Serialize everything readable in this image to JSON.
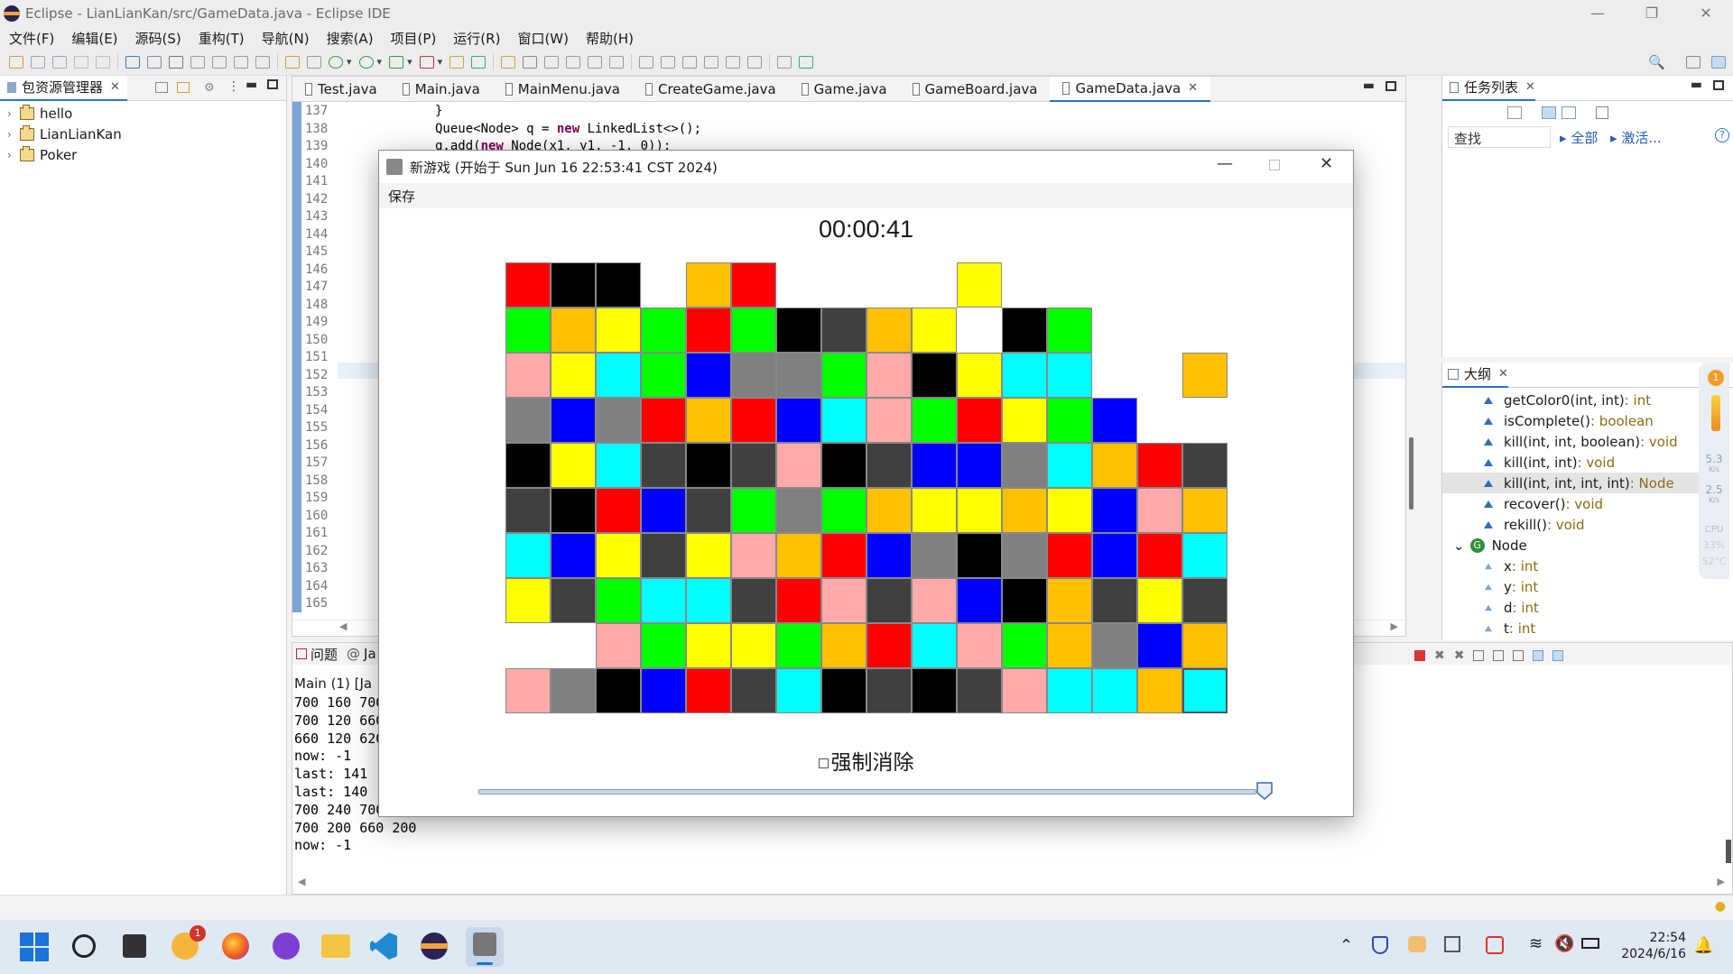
{
  "window": {
    "title": "Eclipse - LianLianKan/src/GameData.java - Eclipse IDE"
  },
  "menubar": [
    "文件(F)",
    "编辑(E)",
    "源码(S)",
    "重构(T)",
    "导航(N)",
    "搜索(A)",
    "项目(P)",
    "运行(R)",
    "窗口(W)",
    "帮助(H)"
  ],
  "package_explorer": {
    "title": "包资源管理器",
    "items": [
      "hello",
      "LianLianKan",
      "Poker"
    ]
  },
  "editor": {
    "tabs": [
      "Test.java",
      "Main.java",
      "MainMenu.java",
      "CreateGame.java",
      "Game.java",
      "GameBoard.java",
      "GameData.java"
    ],
    "active_tab": "GameData.java",
    "line_numbers": [
      "137",
      "138",
      "139",
      "140",
      "141",
      "142",
      "143",
      "144",
      "145",
      "146",
      "147",
      "148",
      "149",
      "150",
      "151",
      "152",
      "153",
      "154",
      "155",
      "156",
      "157",
      "158",
      "159",
      "160",
      "161",
      "162",
      "163",
      "164",
      "165"
    ],
    "code_lines": [
      {
        "line": "137",
        "pre": "}",
        "kw": "",
        "post": ""
      },
      {
        "line": "138",
        "pre": "Queue<Node> q = ",
        "kw": "new",
        "post": " LinkedList<>();"
      },
      {
        "line": "139",
        "pre": "q.add(",
        "kw": "new",
        "post": " Node(x1, y1, -1, 0));"
      }
    ]
  },
  "tasks": {
    "title": "任务列表",
    "search_placeholder": "查找",
    "filter_all": "全部",
    "activate": "激活..."
  },
  "outline": {
    "title": "大纲",
    "items": [
      {
        "name": "getColor0(int, int)",
        "type": " : int"
      },
      {
        "name": "isComplete()",
        "type": " : boolean"
      },
      {
        "name": "kill(int, int, boolean)",
        "type": " : void"
      },
      {
        "name": "kill(int, int)",
        "type": " : void"
      },
      {
        "name": "kill(int, int, int, int)",
        "type": " : Node"
      },
      {
        "name": "recover()",
        "type": " : void"
      },
      {
        "name": "rekill()",
        "type": " : void"
      }
    ],
    "class_name": "Node",
    "fields": [
      {
        "name": "x",
        "type": " : int"
      },
      {
        "name": "y",
        "type": " : int"
      },
      {
        "name": "d",
        "type": " : int"
      },
      {
        "name": "t",
        "type": " : int"
      }
    ]
  },
  "console": {
    "tabs": [
      "问题",
      "Ja"
    ],
    "header": "Main (1)  [Ja",
    "lines": [
      "700 160 700",
      "700 120 660",
      "660 120 620",
      "now: -1",
      "last: 141",
      "last: 140",
      "700 240 700",
      "700 200 660 200",
      "now: -1"
    ]
  },
  "gauge": {
    "upload": "5.3",
    "upload_unit": "K/s",
    "download": "2.5",
    "download_unit": "K/s",
    "cpu_label": "CPU",
    "cpu": "33%",
    "temp": "52°C",
    "badge": "1"
  },
  "dialog": {
    "title": "新游戏  (开始于 Sun Jun 16 22:53:41 CST 2024)",
    "menu_save": "保存",
    "timer": "00:00:41",
    "force_label": "强制消除",
    "force_checked": false,
    "slider_value_pct": 100
  },
  "colors": {
    "R": "#ff0000",
    "K": "#000000",
    "Y": "#ffff00",
    "O": "#ffc000",
    "G": "#00ff00",
    "D": "#404040",
    "P": "#ffaaaa",
    "C": "#00ffff",
    "B": "#0000ff",
    "M": "#808080"
  },
  "board": [
    "RKK.OR....Y.....",
    "GOYGRGKDOY.KG...",
    "PYCGBMMGPKYCC..O",
    "MBMROR BCPGRYGB..",
    "KYCDKDPKDBBMCORD",
    "DKRBDGMGOYYOYBPO",
    "CBYDYPORBMKMRBRC",
    "YDGCCDRPDPBKODYD",
    "..PGYYGORCPGOMBO",
    "PMKBRDCKDKDPCCOC"
  ],
  "taskbar": {
    "time": "22:54",
    "date": "2024/6/16",
    "notif_badge": "1"
  }
}
